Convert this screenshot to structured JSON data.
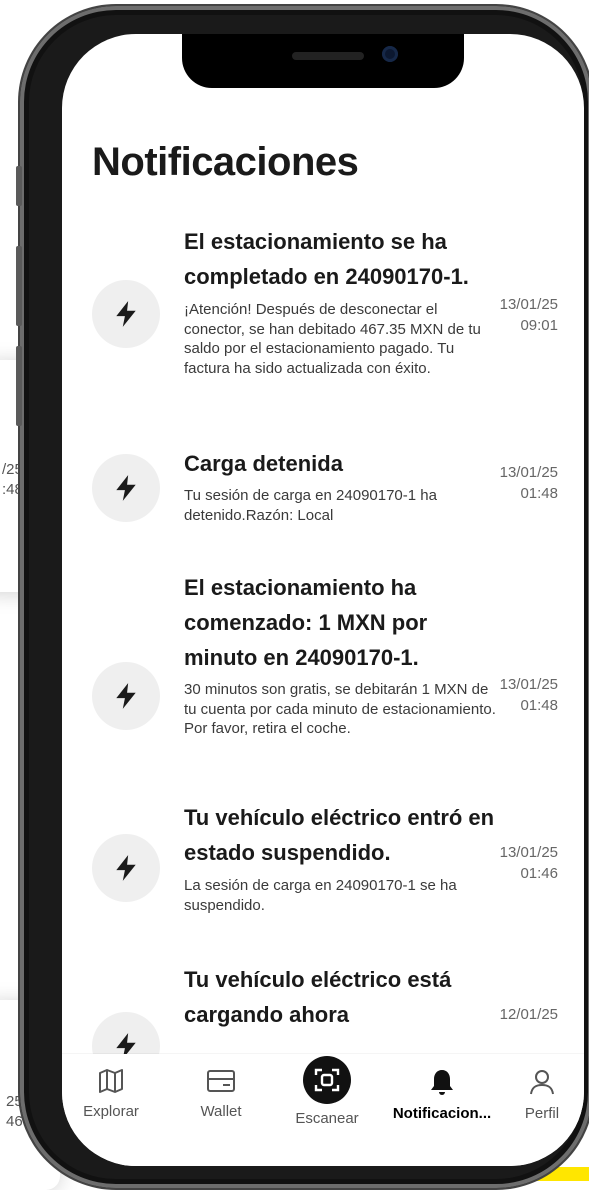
{
  "page": {
    "title": "Notificaciones"
  },
  "background_cards": [
    {
      "date": "/25",
      "time": ":48"
    },
    {
      "date": "25",
      "time": "46"
    }
  ],
  "notifications": [
    {
      "icon": "bolt-icon",
      "title": "El estacionamiento se ha completado en 24090170-1.",
      "body": "¡Atención! Después de desconectar el conector, se han debitado 467.35 MXN de tu saldo por el estacionamiento pagado. Tu factura ha sido actualizada con éxito.",
      "date": "13/01/25",
      "time": "09:01"
    },
    {
      "icon": "bolt-icon",
      "title": "Carga detenida",
      "body": "Tu sesión de carga en 24090170-1 ha detenido.Razón: Local",
      "date": "13/01/25",
      "time": "01:48"
    },
    {
      "icon": "bolt-icon",
      "title": "El estacionamiento ha comenzado: 1 MXN por minuto en 24090170-1.",
      "body": "30 minutos son gratis, se debitarán 1 MXN de tu cuenta por cada minuto de estacionamiento. Por favor, retira el coche.",
      "date": "13/01/25",
      "time": "01:48"
    },
    {
      "icon": "bolt-icon",
      "title": "Tu vehículo eléctrico entró en estado suspendido.",
      "body": "La sesión de carga en 24090170-1 se ha suspendido.",
      "date": "13/01/25",
      "time": "01:46"
    },
    {
      "icon": "bolt-icon",
      "title": "Tu vehículo eléctrico está cargando ahora",
      "body": "",
      "date": "12/01/25",
      "time": ""
    }
  ],
  "nav": {
    "explore": {
      "label": "Explorar",
      "icon": "map-icon"
    },
    "wallet": {
      "label": "Wallet",
      "icon": "wallet-icon"
    },
    "scan": {
      "label": "Escanear",
      "icon": "scan-icon"
    },
    "notifications": {
      "label": "Notificacion...",
      "icon": "bell-icon"
    },
    "profile": {
      "label": "Perfil",
      "icon": "person-icon"
    }
  },
  "colors": {
    "accent": "#111111",
    "icon_bg": "#efefef",
    "corner": "#ffe600"
  }
}
